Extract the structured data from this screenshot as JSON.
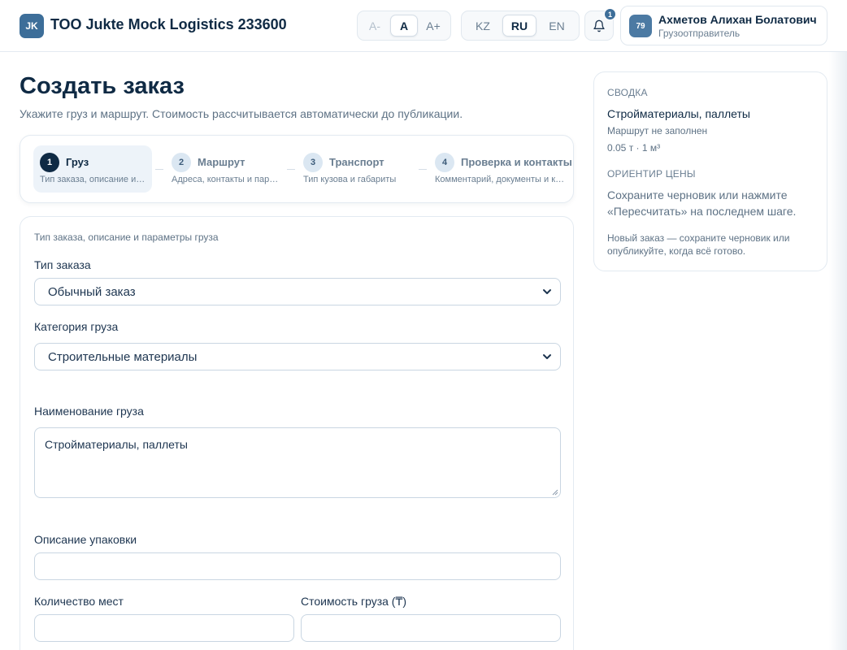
{
  "header": {
    "logo_initials": "JK",
    "company": "ТОО Jukte Mock Logistics 233600",
    "font_size": [
      {
        "label": "A-",
        "state": "disabled"
      },
      {
        "label": "A",
        "state": "active"
      },
      {
        "label": "A+",
        "state": "normal"
      }
    ],
    "languages": [
      {
        "label": "KZ",
        "state": "normal"
      },
      {
        "label": "RU",
        "state": "active"
      },
      {
        "label": "EN",
        "state": "normal"
      }
    ],
    "notifications_count": "1",
    "user": {
      "avatar": "79",
      "name": "Ахметов Алихан Болатович",
      "role": "Грузоотправитель"
    }
  },
  "page": {
    "title": "Создать заказ",
    "subtitle": "Укажите груз и маршрут. Стоимость рассчитывается автоматически до публикации."
  },
  "steps": [
    {
      "num": "1",
      "title": "Груз",
      "desc": "Тип заказа, описание и параметры груза",
      "active": true
    },
    {
      "num": "2",
      "title": "Маршрут",
      "desc": "Адреса, контакты и параметры маршрута",
      "active": false
    },
    {
      "num": "3",
      "title": "Транспорт",
      "desc": "Тип кузова и габариты",
      "active": false
    },
    {
      "num": "4",
      "title": "Проверка и контакты",
      "desc": "Комментарий, документы и контакты",
      "active": false
    }
  ],
  "form": {
    "section_caption": "Тип заказа, описание и параметры груза",
    "order_type_label": "Тип заказа",
    "order_type_value": "Обычный заказ",
    "category_label": "Категория груза",
    "category_value": "Строительные материалы",
    "cargo_name_label": "Наименование груза",
    "cargo_name_value": "Стройматериалы, паллеты",
    "packaging_label": "Описание упаковки",
    "packaging_value": "",
    "places_label": "Количество мест",
    "places_value": "",
    "cargo_cost_label": "Стоимость груза (₸)",
    "cargo_cost_value": ""
  },
  "summary": {
    "heading": "СВОДКА",
    "cargo": "Стройматериалы, паллеты",
    "route": "Маршрут не заполнен",
    "metrics": "0.05 т · 1 м³",
    "price_heading": "ОРИЕНТИР ЦЕНЫ",
    "price_text": "Сохраните черновик или нажмите «Пересчитать» на последнем шаге.",
    "note": "Новый заказ — сохраните черновик или опубликуйте, когда всё готово."
  },
  "colors": {
    "primary": "#0f2a44",
    "accent": "#3d6e99",
    "border": "#c9d6e2",
    "active_step_bg": "#edf3f9"
  }
}
